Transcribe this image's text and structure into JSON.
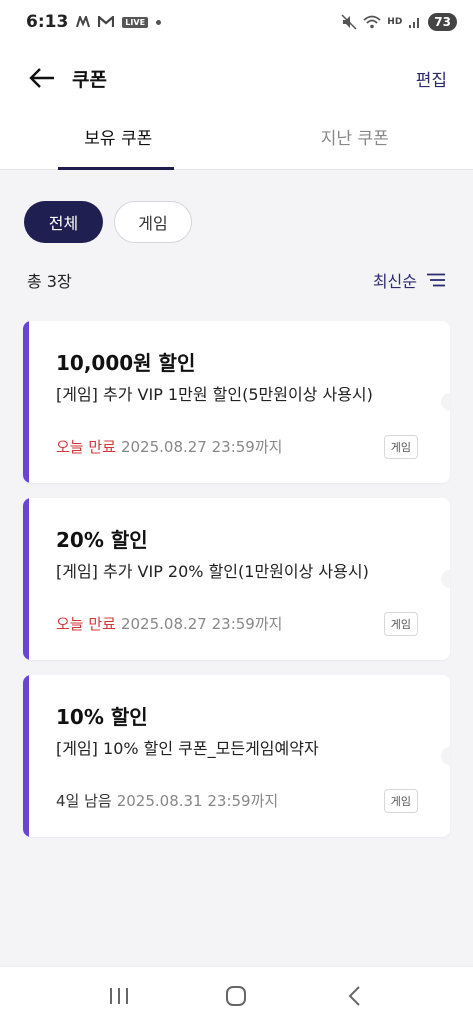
{
  "status_bar": {
    "time": "6:13",
    "icons_left": [
      "m-logo-icon",
      "gmail-icon",
      "live-icon",
      "dot-icon"
    ],
    "live_label": "LIVE",
    "icons_right": [
      "mute-icon",
      "wifi-icon",
      "hd-voice-icon",
      "signal-icon"
    ],
    "hd_label": "HD",
    "battery": "73"
  },
  "header": {
    "title": "쿠폰",
    "edit_label": "편집",
    "accent_color": "#2d2a6e"
  },
  "tabs": [
    {
      "label": "보유 쿠폰",
      "active": true
    },
    {
      "label": "지난 쿠폰",
      "active": false
    }
  ],
  "filters": {
    "all_label": "전체",
    "game_label": "게임",
    "selected": "전체",
    "selected_color": "#201f52"
  },
  "list_meta": {
    "count_label": "총 3장",
    "sort_label": "최신순"
  },
  "coupons": [
    {
      "title": "10,000원 할인",
      "description": "[게임] 추가 VIP 1만원 할인(5만원이상 사용시)",
      "expiry_label": "오늘 만료",
      "expiry_date": "2025.08.27 23:59까지",
      "tag": "게임",
      "expiry_urgent": true
    },
    {
      "title": "20% 할인",
      "description": "[게임] 추가 VIP 20% 할인(1만원이상 사용시)",
      "expiry_label": "오늘 만료",
      "expiry_date": "2025.08.27 23:59까지",
      "tag": "게임",
      "expiry_urgent": true
    },
    {
      "title": "10% 할인",
      "description": "[게임] 10% 할인 쿠폰_모든게임예약자",
      "expiry_label": "4일 남음",
      "expiry_date": "2025.08.31 23:59까지",
      "tag": "게임",
      "expiry_urgent": false
    }
  ],
  "colors": {
    "card_accent": "#6a44d4",
    "urgent_text": "#d23a3a",
    "background": "#f4f4f6"
  },
  "nav_bar": {
    "icons": [
      "recent-apps-icon",
      "home-icon",
      "back-nav-icon"
    ]
  }
}
